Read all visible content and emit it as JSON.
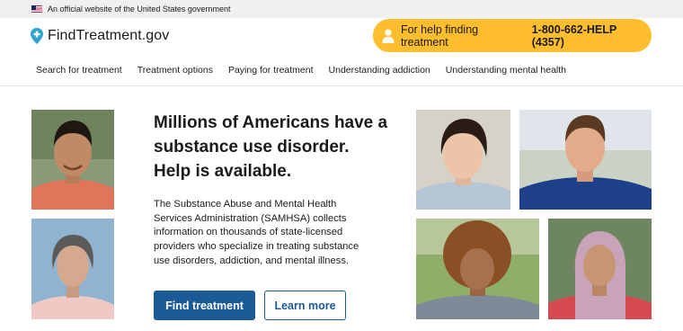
{
  "gov_banner": {
    "text": "An official website of the United States government"
  },
  "header": {
    "logo_text": "FindTreatment.gov",
    "help_pill": {
      "text": "For help finding treatment",
      "phone": "1-800-662-HELP (4357)"
    }
  },
  "nav": {
    "items": [
      {
        "label": "Search for treatment"
      },
      {
        "label": "Treatment options"
      },
      {
        "label": "Paying for treatment"
      },
      {
        "label": "Understanding addiction"
      },
      {
        "label": "Understanding mental health"
      }
    ]
  },
  "hero": {
    "headline_lines": [
      "Millions of Americans have a",
      "substance use disorder.",
      "Help is available."
    ],
    "body_lines": [
      "The Substance Abuse and Mental Health",
      "Services Administration (SAMHSA) collects",
      "information on thousands of state-licensed",
      "providers who specialize in treating substance",
      "use disorders, addiction, and mental illness."
    ],
    "primary_button": "Find treatment",
    "secondary_button": "Learn more"
  },
  "colors": {
    "gov_banner_bg": "#f0f0f0",
    "help_pill_bg": "#ffbe2e",
    "primary": "#1a5a96",
    "logo_pin": "#2ea5ce"
  },
  "icons": {
    "flag": "us-flag-icon",
    "logo": "map-pin-icon",
    "help": "person-icon"
  }
}
